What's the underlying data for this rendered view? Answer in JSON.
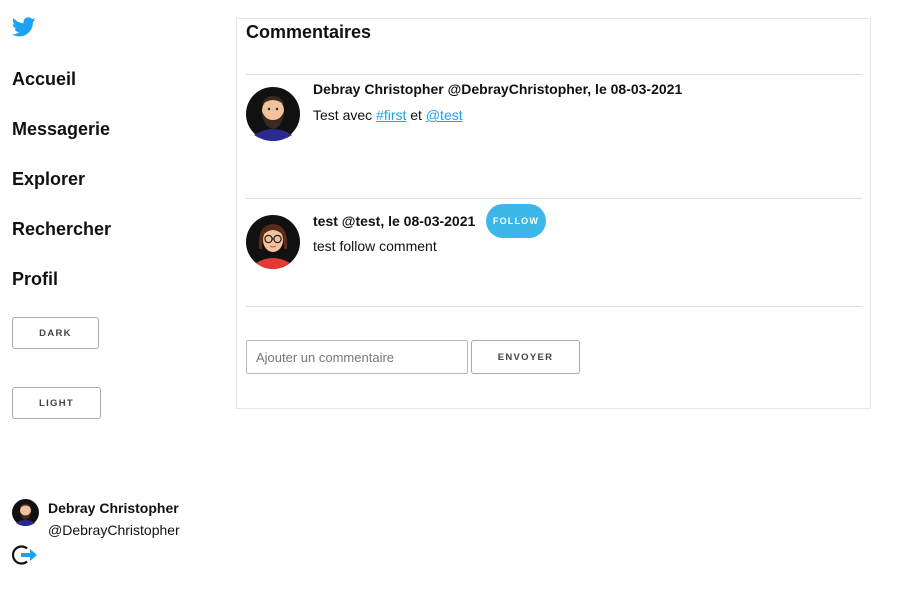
{
  "sidebar": {
    "logo_icon": "twitter-bird-icon",
    "nav": [
      {
        "label": "Accueil"
      },
      {
        "label": "Messagerie"
      },
      {
        "label": "Explorer"
      },
      {
        "label": "Rechercher"
      },
      {
        "label": "Profil"
      }
    ],
    "dark_label": "DARK",
    "light_label": "LIGHT",
    "user": {
      "name": "Debray Christopher",
      "handle": "@DebrayChristopher"
    },
    "logout_icon": "logout-icon"
  },
  "main": {
    "title": "Commentaires",
    "comments": [
      {
        "meta": "Debray Christopher @DebrayChristopher, le 08-03-2021",
        "text_prefix": "Test avec ",
        "hashtag": "#first",
        "text_middle": " et ",
        "mention": "@test"
      },
      {
        "meta": "test  @test, le 08-03-2021",
        "text": "test follow comment",
        "follow_label": "FOLLOW"
      }
    ],
    "input_placeholder": "Ajouter un commentaire",
    "send_label": "ENVOYER"
  },
  "colors": {
    "accent": "#1da1f2",
    "follow_button": "#3bb7ea",
    "divider": "#dcdcdc"
  }
}
